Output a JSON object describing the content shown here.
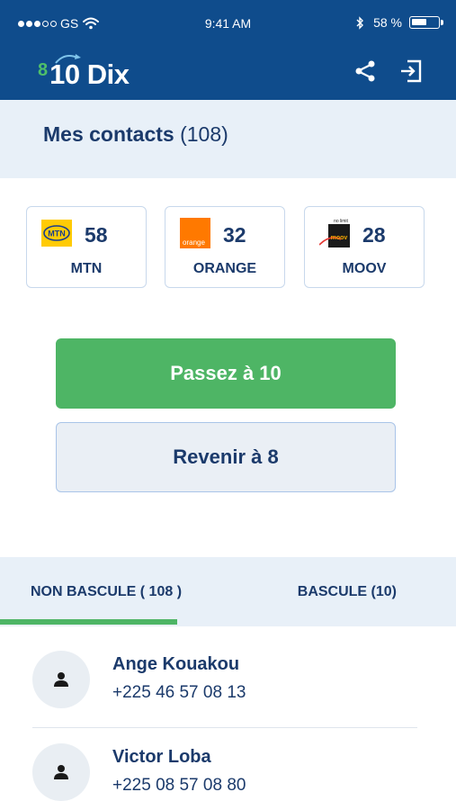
{
  "status_bar": {
    "carrier": "GS",
    "time": "9:41 AM",
    "battery_text": "58 %",
    "battery_level": 0.58
  },
  "header": {
    "logo_small": "8",
    "logo_main": "10 Dix"
  },
  "page": {
    "title": "Mes contacts",
    "count": "(108)"
  },
  "operators": [
    {
      "name": "MTN",
      "count": "58",
      "logo_icon": "mtn-logo-icon",
      "logo_text": "MTN",
      "color": "#ffcb05"
    },
    {
      "name": "ORANGE",
      "count": "32",
      "logo_icon": "orange-logo-icon",
      "logo_text": "orange",
      "color": "#ff7900"
    },
    {
      "name": "MOOV",
      "count": "28",
      "logo_icon": "moov-logo-icon",
      "logo_text": "moov",
      "logo_caption": "no limit",
      "color": "#1a1a1a"
    }
  ],
  "actions": {
    "primary": "Passez à 10",
    "secondary": "Revenir à 8"
  },
  "tabs": [
    {
      "label": "NON BASCULE ( 108 )",
      "active": true
    },
    {
      "label": "BASCULE (10)",
      "active": false
    }
  ],
  "contacts": [
    {
      "name": "Ange Kouakou",
      "phone": "+225 46 57 08 13"
    },
    {
      "name": "Victor Loba",
      "phone": "+225 08 57 08 80"
    }
  ],
  "colors": {
    "header_bg": "#0f4c8c",
    "accent_green": "#4eb565",
    "text_navy": "#1b3a6b",
    "band_bg": "#e8f0f8"
  }
}
